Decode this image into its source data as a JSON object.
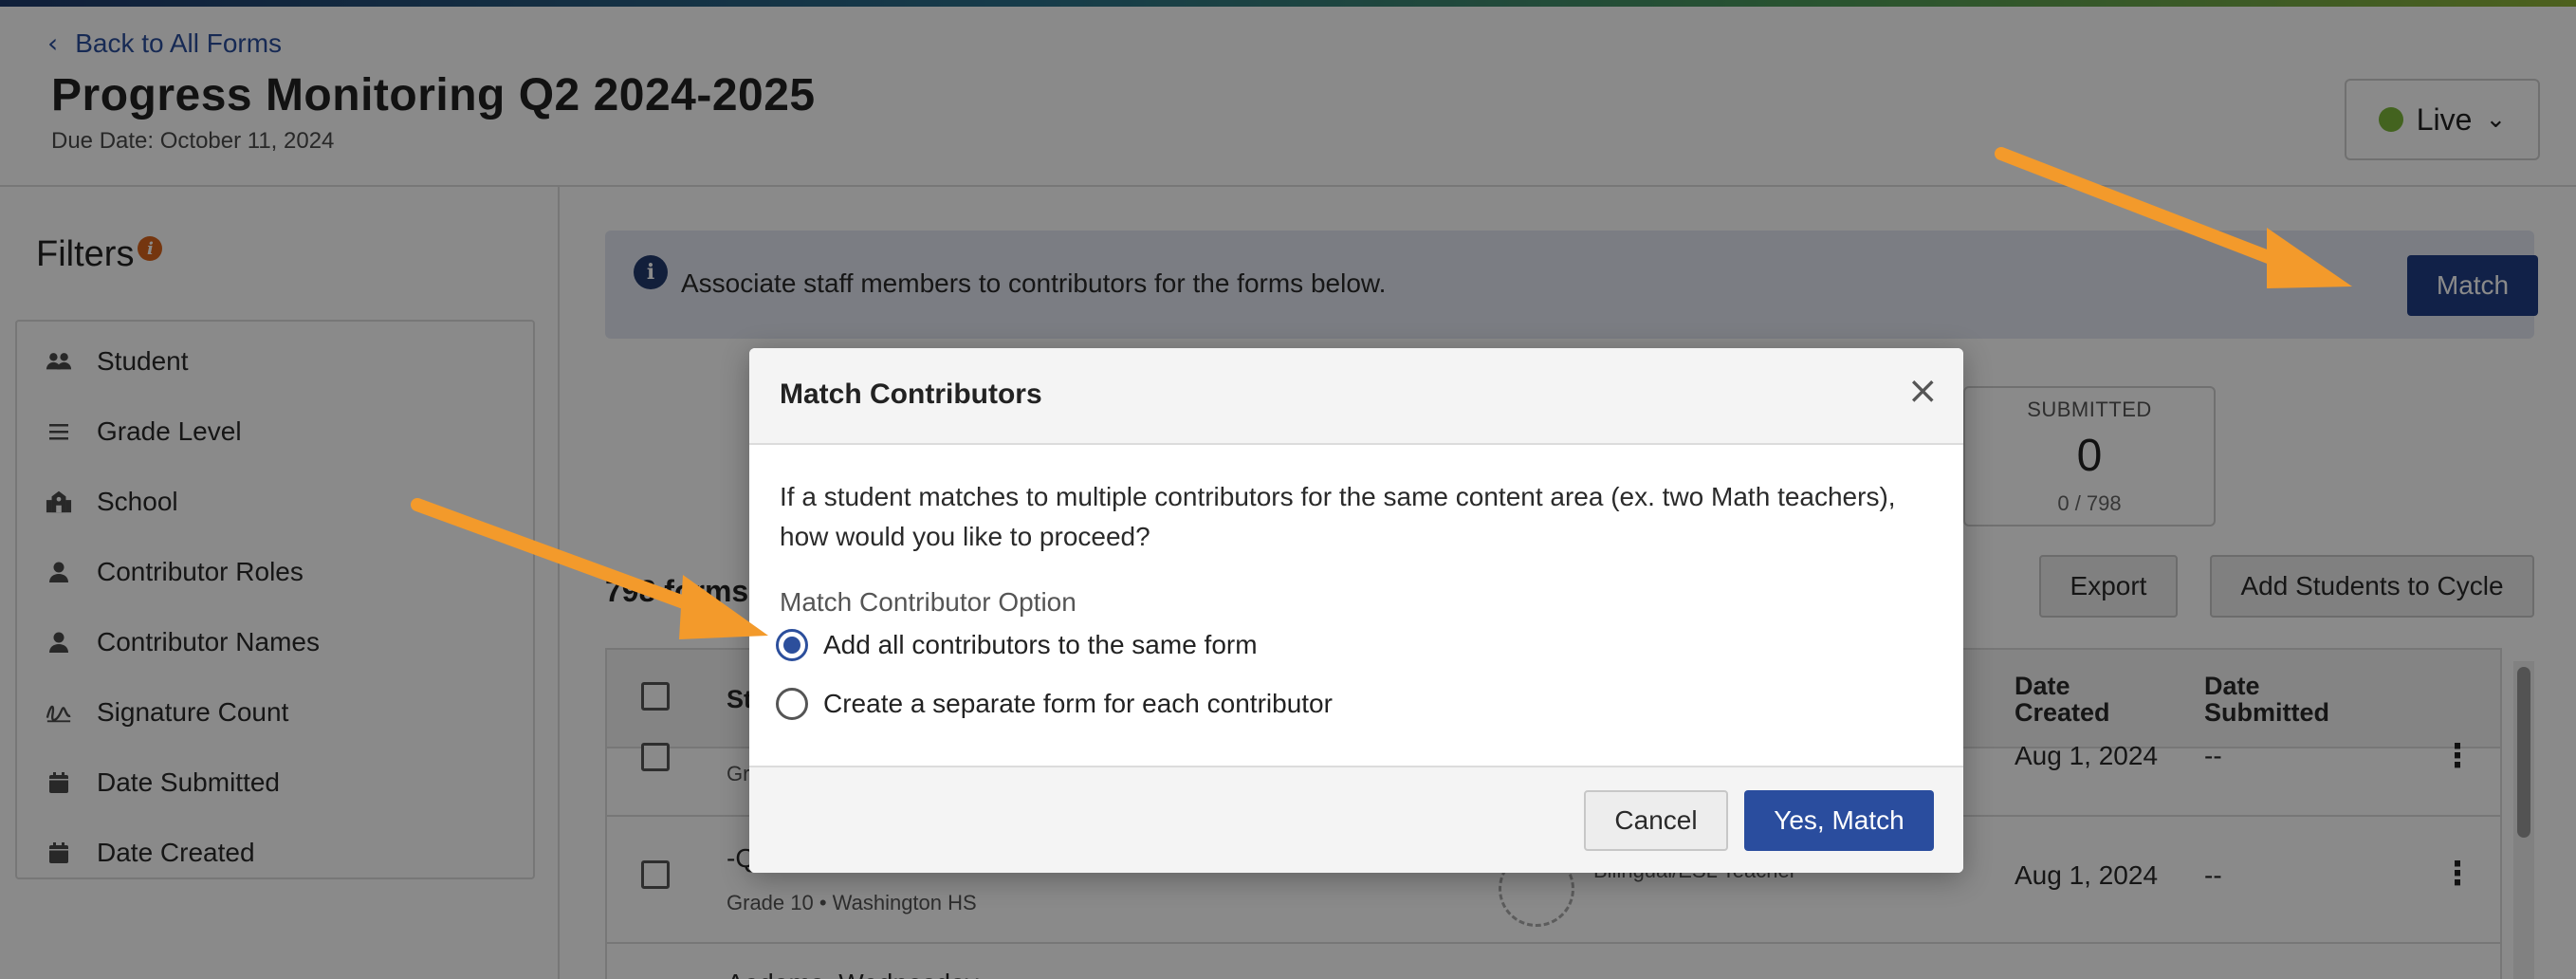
{
  "header": {
    "back_label": "Back to All Forms",
    "title": "Progress Monitoring Q2 2024-2025",
    "due_date": "Due Date: October 11, 2024",
    "status_label": "Live"
  },
  "sidebar": {
    "title": "Filters",
    "info_glyph": "i",
    "items": [
      {
        "label": "Student",
        "icon": "users-icon"
      },
      {
        "label": "Grade Level",
        "icon": "list-icon"
      },
      {
        "label": "School",
        "icon": "school-icon"
      },
      {
        "label": "Contributor Roles",
        "icon": "person-icon"
      },
      {
        "label": "Contributor Names",
        "icon": "person-icon"
      },
      {
        "label": "Signature Count",
        "icon": "signature-icon"
      },
      {
        "label": "Date Submitted",
        "icon": "calendar-icon"
      },
      {
        "label": "Date Created",
        "icon": "calendar-icon"
      }
    ]
  },
  "banner": {
    "message": "Associate staff members to contributors for the forms below.",
    "match_label": "Match"
  },
  "stats": {
    "submitted_label": "SUBMITTED",
    "submitted_value": "0",
    "submitted_sub": "0 / 798"
  },
  "list": {
    "count_text": "798 forms",
    "export_label": "Export",
    "add_students_label": "Add Students to Cycle",
    "columns": {
      "student": "St",
      "date_created": "Date Created",
      "date_submitted": "Date Submitted"
    },
    "rows": [
      {
        "name": "",
        "sub": "Gr",
        "contributor": "",
        "date_created": "Aug 1, 2024",
        "date_submitted": "--"
      },
      {
        "name": "-Q",
        "sub": "Grade 10 • Washington HS",
        "contributor": "Bilingual/ESL Teacher",
        "date_created": "Aug 1, 2024",
        "date_submitted": "--"
      },
      {
        "name": "Aadams, Wednesday",
        "sub": "",
        "contributor": "",
        "date_created": "",
        "date_submitted": ""
      }
    ]
  },
  "modal": {
    "title": "Match Contributors",
    "close_glyph": "×",
    "body": "If a student matches to multiple contributors for the same content area (ex. two Math teachers), how would you like to proceed?",
    "option_label": "Match Contributor Option",
    "options": [
      {
        "label": "Add all contributors to the same form",
        "selected": true
      },
      {
        "label": "Create a separate form for each contributor",
        "selected": false
      }
    ],
    "cancel_label": "Cancel",
    "confirm_label": "Yes, Match"
  },
  "colors": {
    "primary": "#2a4d9e",
    "status_live": "#7cb83a",
    "annotation_arrow": "#f39a2b"
  }
}
